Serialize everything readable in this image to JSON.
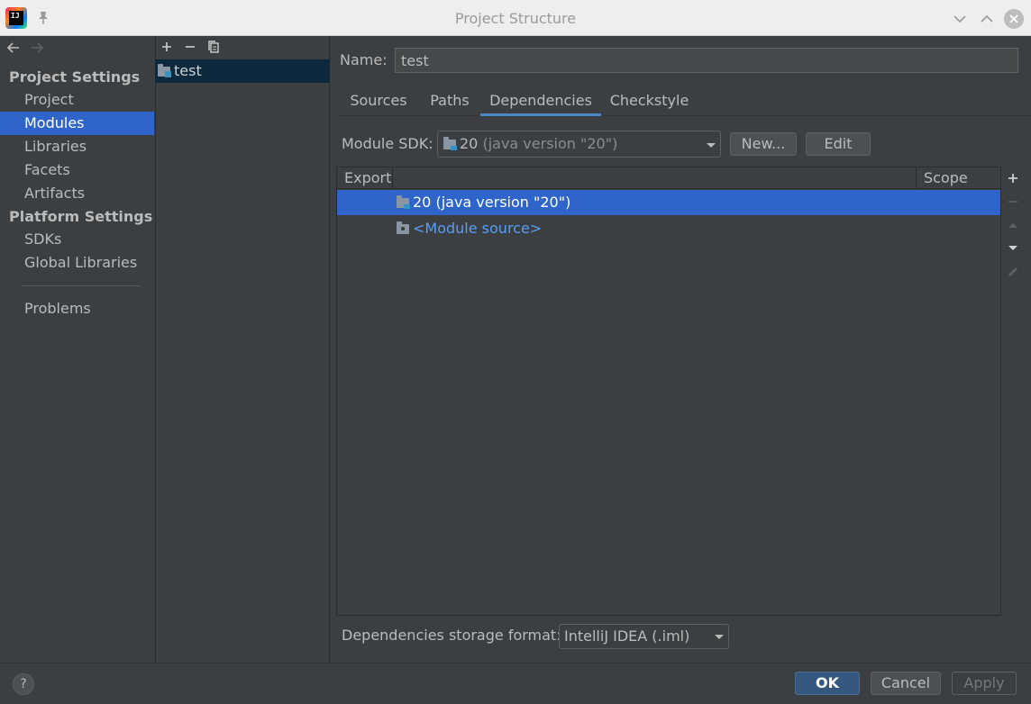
{
  "window": {
    "title": "Project Structure"
  },
  "sidebar": {
    "project_settings_header": "Project Settings",
    "project_items": [
      {
        "label": "Project",
        "selected": false
      },
      {
        "label": "Modules",
        "selected": true
      },
      {
        "label": "Libraries",
        "selected": false
      },
      {
        "label": "Facets",
        "selected": false
      },
      {
        "label": "Artifacts",
        "selected": false
      }
    ],
    "platform_settings_header": "Platform Settings",
    "platform_items": [
      {
        "label": "SDKs"
      },
      {
        "label": "Global Libraries"
      }
    ],
    "problems_label": "Problems"
  },
  "module_list": {
    "toolbar": {
      "add": "+",
      "remove": "−",
      "copy": "copy"
    },
    "items": [
      {
        "label": "test",
        "selected": true
      }
    ]
  },
  "main": {
    "name_label": "Name:",
    "name_value": "test",
    "tabs": [
      {
        "label": "Sources",
        "selected": false
      },
      {
        "label": "Paths",
        "selected": false
      },
      {
        "label": "Dependencies",
        "selected": true
      },
      {
        "label": "Checkstyle",
        "selected": false
      }
    ],
    "module_sdk_label": "Module SDK:",
    "module_sdk": {
      "version": "20",
      "detail": "(java version \"20\")"
    },
    "new_button": "New...",
    "edit_button": "Edit",
    "table": {
      "columns": [
        "Export",
        "Scope"
      ],
      "rows": [
        {
          "label": "20 (java version \"20\")",
          "icon": "sdk-folder-icon",
          "selected": true,
          "scope": ""
        },
        {
          "label": "<Module source>",
          "icon": "folder-icon",
          "selected": false,
          "scope": ""
        }
      ]
    },
    "storage_format_label": "Dependencies storage format:",
    "storage_format_value": "IntelliJ IDEA (.iml)"
  },
  "footer": {
    "help": "?",
    "ok": "OK",
    "cancel": "Cancel",
    "apply": "Apply"
  },
  "colors": {
    "background": "#3c3f41",
    "selection": "#2f65ca",
    "link": "#589df6",
    "tab_underline": "#4a88c7",
    "ok_button": "#365880"
  }
}
